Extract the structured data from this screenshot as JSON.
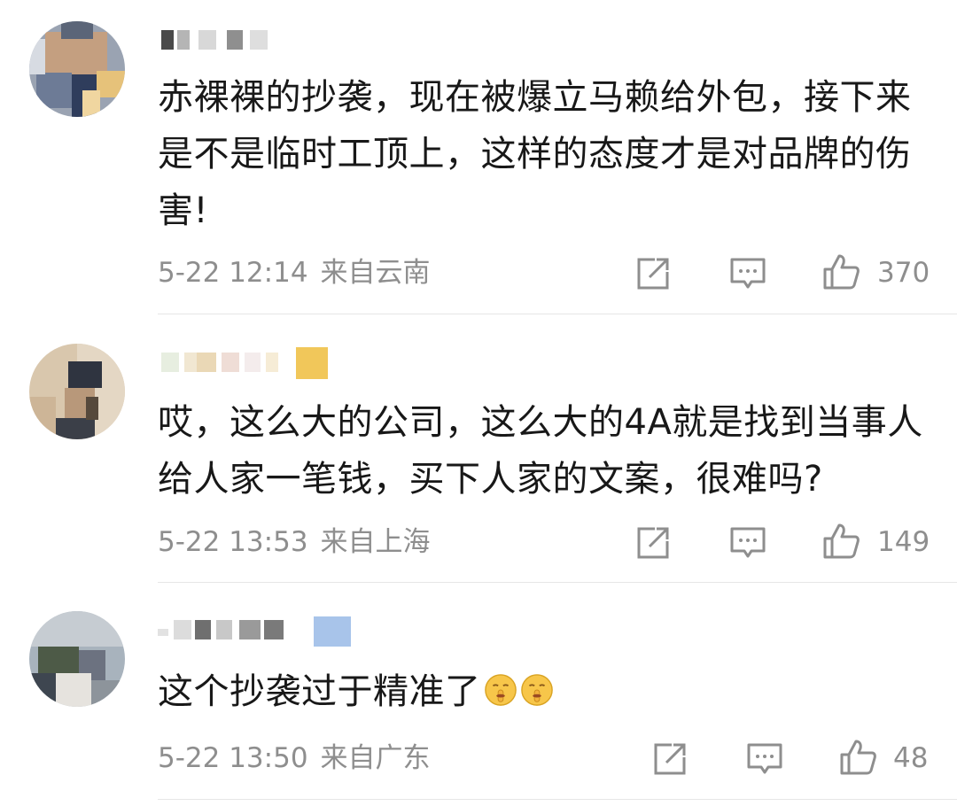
{
  "comments": [
    {
      "text": "赤裸裸的抄袭，现在被爆立马赖给外包，接下来是不是临时工顶上，这样的态度才是对品牌的伤害!",
      "date": "5-22 12:14",
      "location": "来自云南",
      "likes": "370",
      "icons": [
        "share-icon",
        "comment-icon",
        "like-icon"
      ],
      "avatar_colors": [
        "#7a8aa0",
        "#c8a585",
        "#3c4e6e",
        "#ededed"
      ]
    },
    {
      "text": "哎，这么大的公司，这么大的4A就是找到当事人给人家一笔钱，买下人家的文案，很难吗?",
      "date": "5-22 13:53",
      "location": "来自上海",
      "likes": "149",
      "icons": [
        "share-icon",
        "comment-icon",
        "like-icon"
      ],
      "avatar_colors": [
        "#d8c8b0",
        "#2e3440",
        "#b99a7a",
        "#ece3d6"
      ]
    },
    {
      "text": "这个抄袭过于精准了",
      "emoji": [
        "shushing-face-emoji",
        "shushing-face-emoji"
      ],
      "date": "5-22 13:50",
      "location": "来自广东",
      "likes": "48",
      "icons": [
        "share-icon",
        "comment-icon",
        "like-icon"
      ],
      "avatar_colors": [
        "#8a9aa8",
        "#3f4a3a",
        "#c9c2b8",
        "#e9e9e9"
      ]
    }
  ],
  "colors": {
    "text": "#181818",
    "meta": "#8e8e8e",
    "divider": "#e6e6e6",
    "background": "#ffffff"
  }
}
